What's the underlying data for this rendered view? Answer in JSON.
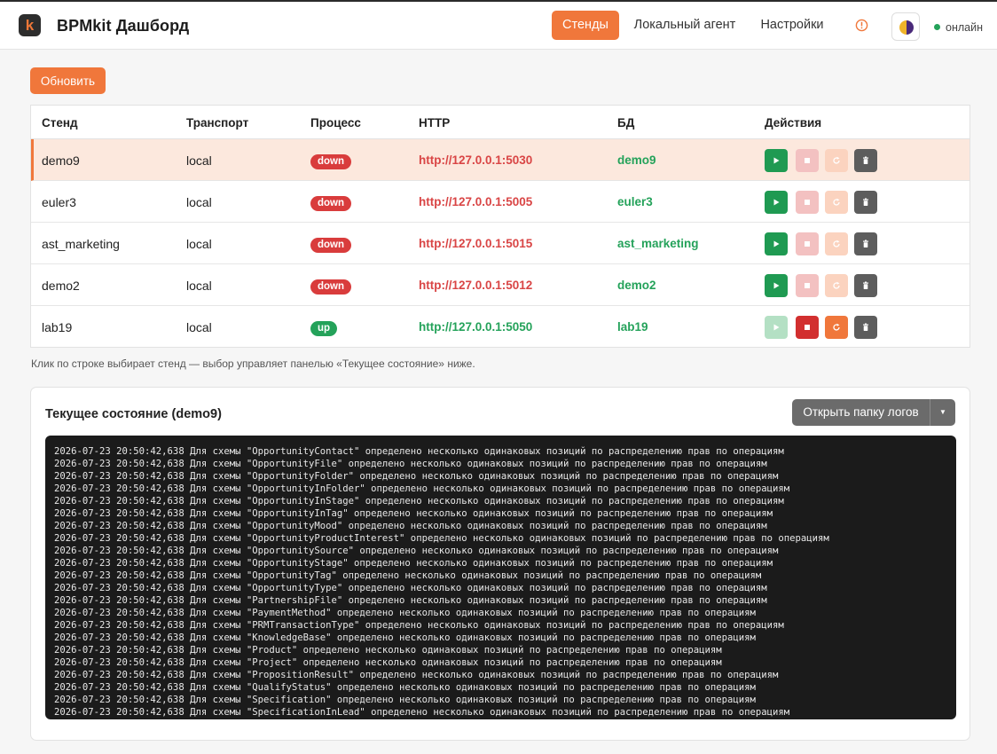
{
  "app": {
    "logo_letter": "k",
    "title": "BPMkit Дашборд"
  },
  "nav": {
    "stands": "Стенды",
    "agent": "Локальный агент",
    "settings": "Настройки"
  },
  "status": {
    "label": "онлайн"
  },
  "toolbar": {
    "refresh_label": "Обновить"
  },
  "table": {
    "columns": [
      "Стенд",
      "Транспорт",
      "Процесс",
      "HTTP",
      "БД",
      "Действия"
    ],
    "rows": [
      {
        "stand": "demo9",
        "transport": "local",
        "process": "down",
        "http": "http://127.0.0.1:5030",
        "db": "demo9",
        "selected": true
      },
      {
        "stand": "euler3",
        "transport": "local",
        "process": "down",
        "http": "http://127.0.0.1:5005",
        "db": "euler3",
        "selected": false
      },
      {
        "stand": "ast_marketing",
        "transport": "local",
        "process": "down",
        "http": "http://127.0.0.1:5015",
        "db": "ast_marketing",
        "selected": false
      },
      {
        "stand": "demo2",
        "transport": "local",
        "process": "down",
        "http": "http://127.0.0.1:5012",
        "db": "demo2",
        "selected": false
      },
      {
        "stand": "lab19",
        "transport": "local",
        "process": "up",
        "http": "http://127.0.0.1:5050",
        "db": "lab19",
        "selected": false
      }
    ]
  },
  "hint": "Клик по строке выбирает стенд — выбор управляет панелью «Текущее состояние» ниже.",
  "panel": {
    "title": "Текущее состояние (demo9)",
    "open_logs_label": "Открыть папку логов",
    "log_lines": [
      "2026-07-23 20:50:42,638 Для схемы \"OpportunityContact\" определено несколько одинаковых позиций по распределению прав по операциям",
      "2026-07-23 20:50:42,638 Для схемы \"OpportunityFile\" определено несколько одинаковых позиций по распределению прав по операциям",
      "2026-07-23 20:50:42,638 Для схемы \"OpportunityFolder\" определено несколько одинаковых позиций по распределению прав по операциям",
      "2026-07-23 20:50:42,638 Для схемы \"OpportunityInFolder\" определено несколько одинаковых позиций по распределению прав по операциям",
      "2026-07-23 20:50:42,638 Для схемы \"OpportunityInStage\" определено несколько одинаковых позиций по распределению прав по операциям",
      "2026-07-23 20:50:42,638 Для схемы \"OpportunityInTag\" определено несколько одинаковых позиций по распределению прав по операциям",
      "2026-07-23 20:50:42,638 Для схемы \"OpportunityMood\" определено несколько одинаковых позиций по распределению прав по операциям",
      "2026-07-23 20:50:42,638 Для схемы \"OpportunityProductInterest\" определено несколько одинаковых позиций по распределению прав по операциям",
      "2026-07-23 20:50:42,638 Для схемы \"OpportunitySource\" определено несколько одинаковых позиций по распределению прав по операциям",
      "2026-07-23 20:50:42,638 Для схемы \"OpportunityStage\" определено несколько одинаковых позиций по распределению прав по операциям",
      "2026-07-23 20:50:42,638 Для схемы \"OpportunityTag\" определено несколько одинаковых позиций по распределению прав по операциям",
      "2026-07-23 20:50:42,638 Для схемы \"OpportunityType\" определено несколько одинаковых позиций по распределению прав по операциям",
      "2026-07-23 20:50:42,638 Для схемы \"PartnershipFile\" определено несколько одинаковых позиций по распределению прав по операциям",
      "2026-07-23 20:50:42,638 Для схемы \"PaymentMethod\" определено несколько одинаковых позиций по распределению прав по операциям",
      "2026-07-23 20:50:42,638 Для схемы \"PRMTransactionType\" определено несколько одинаковых позиций по распределению прав по операциям",
      "2026-07-23 20:50:42,638 Для схемы \"KnowledgeBase\" определено несколько одинаковых позиций по распределению прав по операциям",
      "2026-07-23 20:50:42,638 Для схемы \"Product\" определено несколько одинаковых позиций по распределению прав по операциям",
      "2026-07-23 20:50:42,638 Для схемы \"Project\" определено несколько одинаковых позиций по распределению прав по операциям",
      "2026-07-23 20:50:42,638 Для схемы \"PropositionResult\" определено несколько одинаковых позиций по распределению прав по операциям",
      "2026-07-23 20:50:42,638 Для схемы \"QualifyStatus\" определено несколько одинаковых позиций по распределению прав по операциям",
      "2026-07-23 20:50:42,638 Для схемы \"Specification\" определено несколько одинаковых позиций по распределению прав по операциям",
      "2026-07-23 20:50:42,638 Для схемы \"SpecificationInLead\" определено несколько одинаковых позиций по распределению прав по операциям"
    ]
  },
  "colors": {
    "accent": "#f0773b",
    "up": "#24a25a",
    "down": "#d93c3c",
    "console_bg": "#1b1b1b"
  }
}
